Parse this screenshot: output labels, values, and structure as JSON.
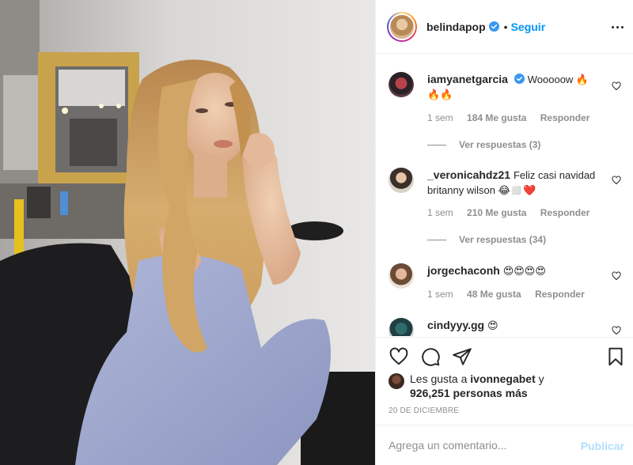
{
  "header": {
    "username": "belindapop",
    "verified": true,
    "separator": "•",
    "follow_label": "Seguir",
    "more_icon": "more-horizontal-icon"
  },
  "comments": [
    {
      "username": "iamyanetgarcia",
      "verified": true,
      "text": "Wooooow 🔥🔥🔥",
      "time": "1 sem",
      "likes": "184 Me gusta",
      "reply_label": "Responder",
      "view_replies": "Ver respuestas (3)"
    },
    {
      "username": "_veronicahdz21",
      "verified": false,
      "text": "Feliz casi navidad britanny wilson 😂◻️❤️",
      "time": "1 sem",
      "likes": "210 Me gusta",
      "reply_label": "Responder",
      "view_replies": "Ver respuestas (34)"
    },
    {
      "username": "jorgechaconh",
      "verified": false,
      "text": "😍😍😍😍",
      "time": "1 sem",
      "likes": "48 Me gusta",
      "reply_label": "Responder"
    },
    {
      "username": "cindyyy.gg",
      "verified": false,
      "text": "😍"
    }
  ],
  "actions": {
    "like_icon": "heart-icon",
    "comment_icon": "comment-icon",
    "share_icon": "share-icon",
    "save_icon": "bookmark-icon"
  },
  "likes": {
    "prefix": "Les gusta a",
    "user": "ivonnegabet",
    "connector": "y",
    "count": "926,251 personas más"
  },
  "date": "20 DE DICIEMBRE",
  "add_comment": {
    "placeholder": "Agrega un comentario...",
    "publish_label": "Publicar"
  },
  "colors": {
    "accent": "#0095f6",
    "publish_disabled": "#b2dffc",
    "secondary_text": "#8e8e8e",
    "primary_text": "#262626"
  }
}
